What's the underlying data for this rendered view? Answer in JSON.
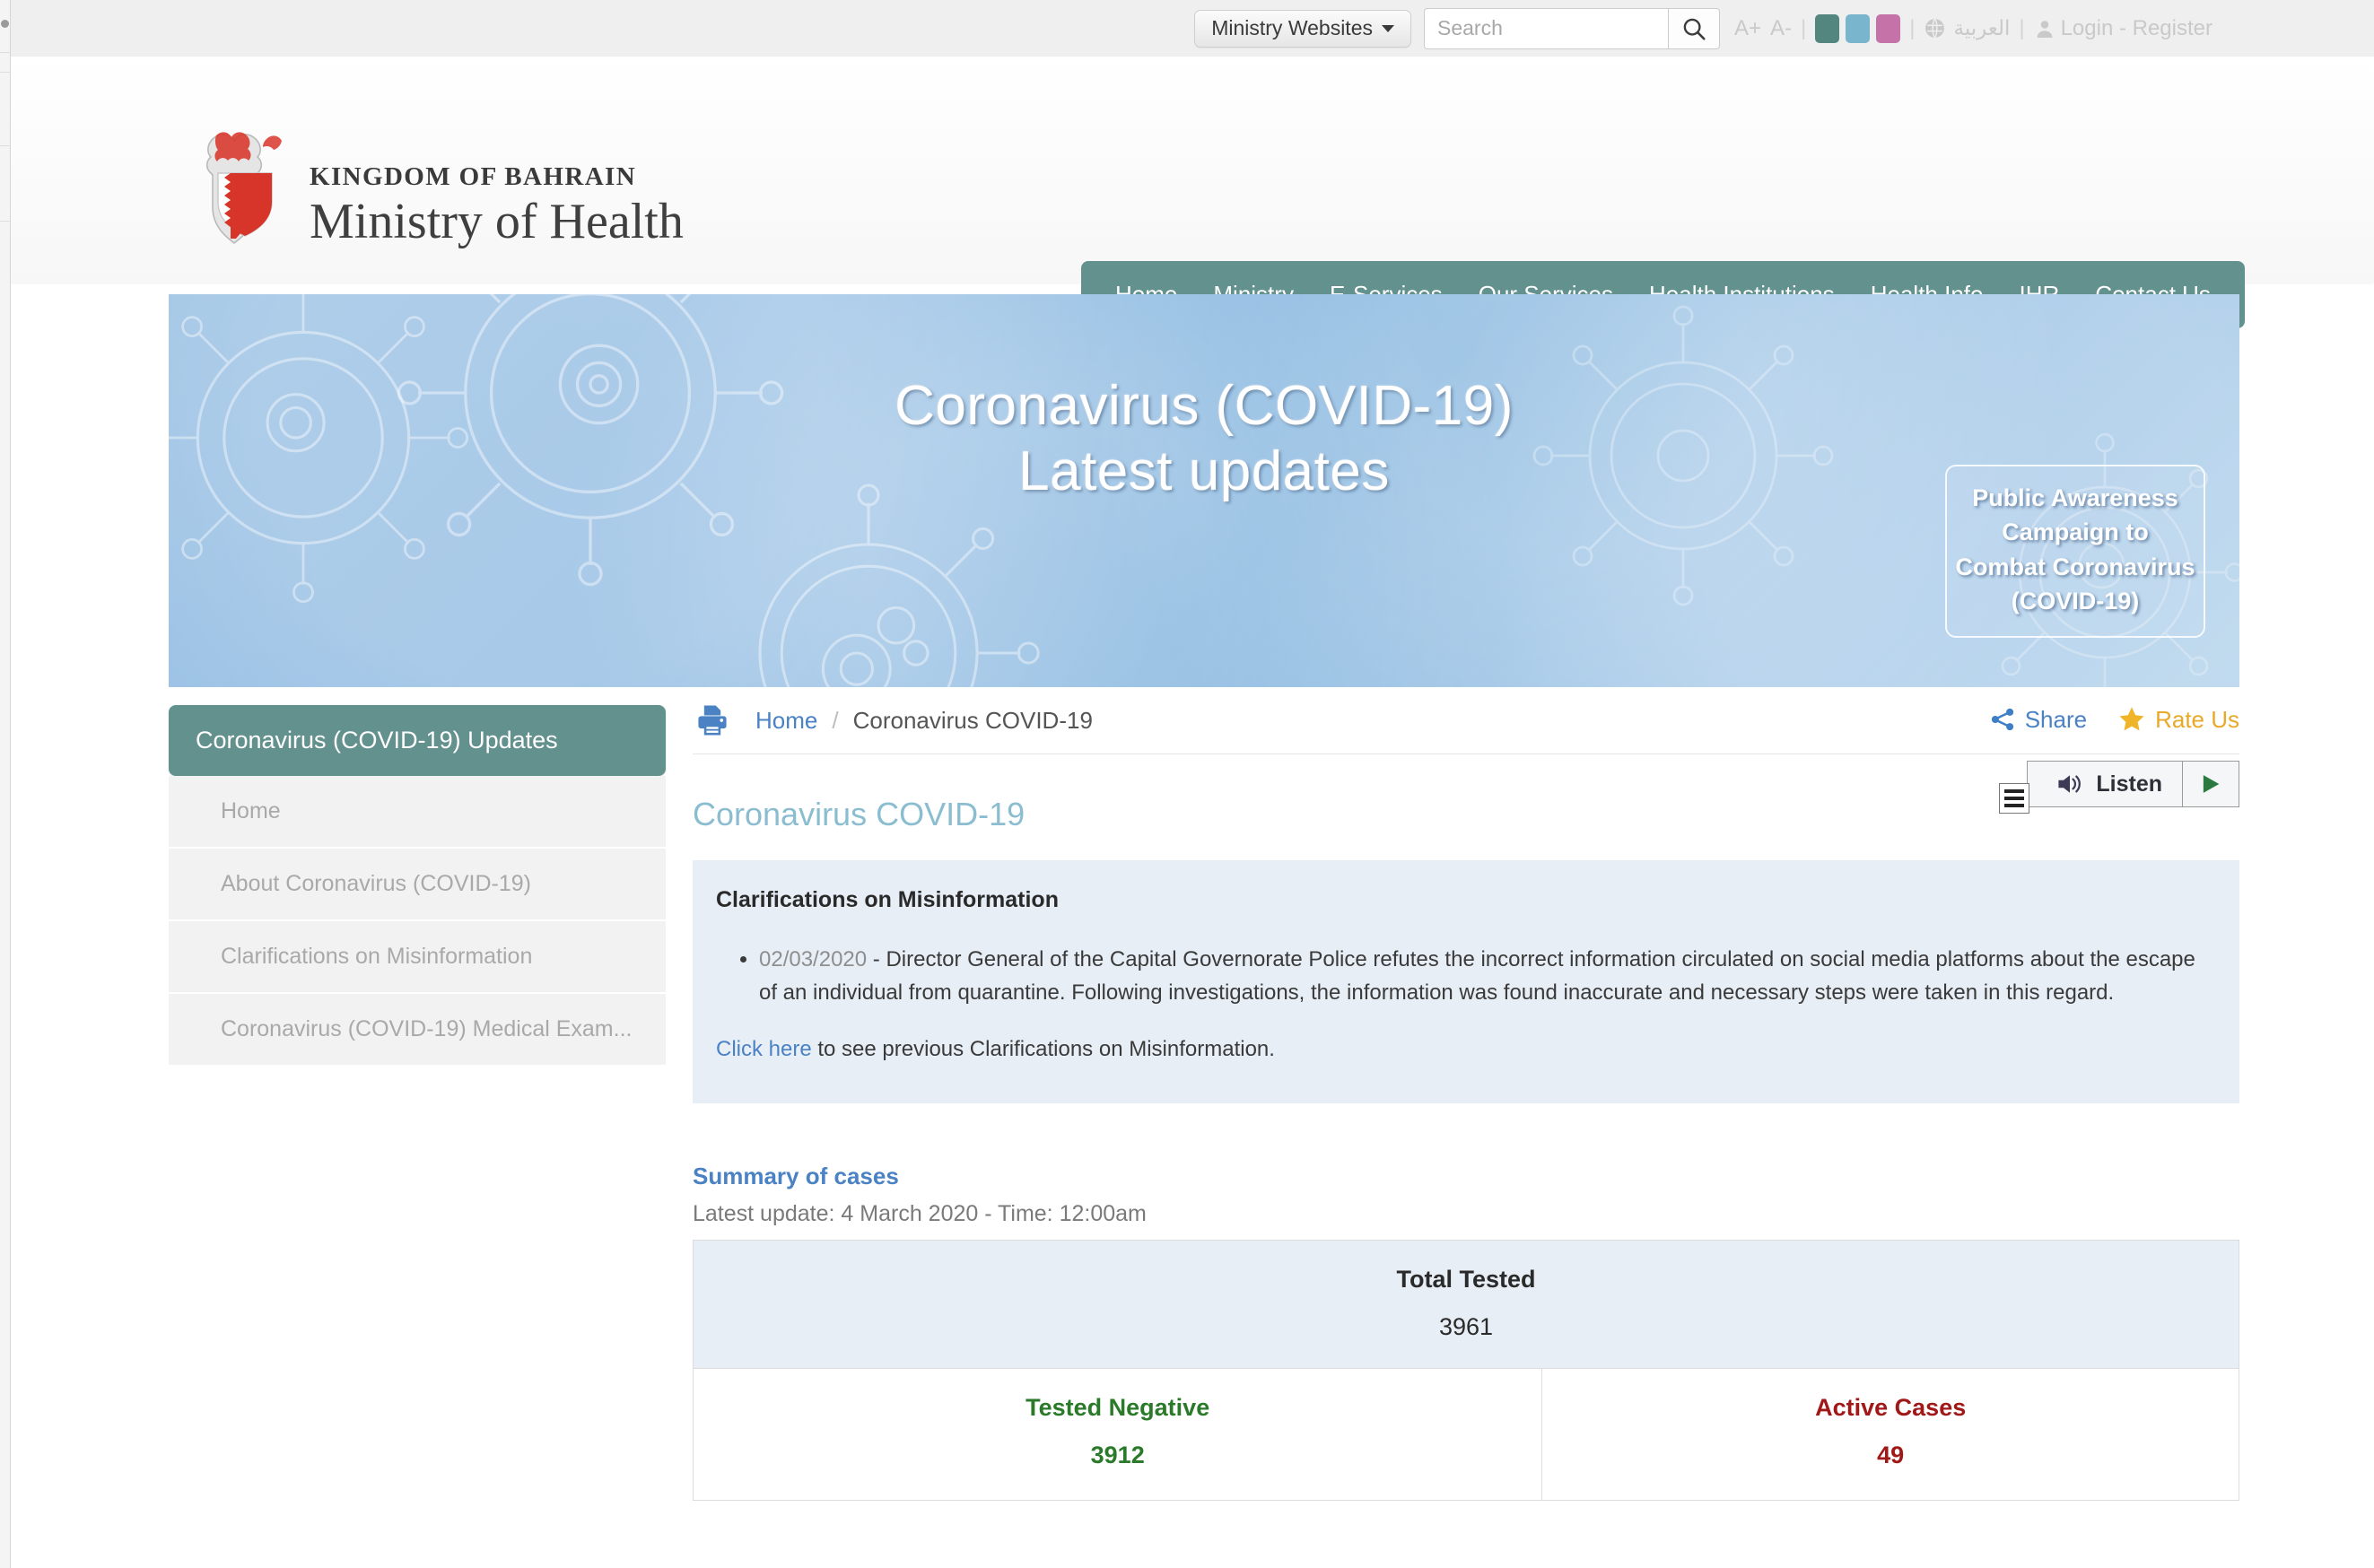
{
  "topbar": {
    "ministry_websites_label": "Ministry Websites",
    "search_placeholder": "Search",
    "search_value": "",
    "font_increase": "A+",
    "font_decrease": "A-",
    "separator": "|",
    "swatch_colors": [
      "#52867f",
      "#79b6cd",
      "#c472a8"
    ],
    "arabic_label": "العربية",
    "auth_label": "Login - Register"
  },
  "logo": {
    "kingdom_line": "KINGDOM OF BAHRAIN",
    "ministry_line": "Ministry of Health"
  },
  "mainnav": {
    "items": [
      {
        "label": "Home"
      },
      {
        "label": "Ministry"
      },
      {
        "label": "E-Services"
      },
      {
        "label": "Our Services"
      },
      {
        "label": "Health Institutions"
      },
      {
        "label": "Health Info"
      },
      {
        "label": "IHR"
      },
      {
        "label": "Contact Us"
      }
    ]
  },
  "hero": {
    "title_line1": "Coronavirus (COVID-19)",
    "title_line2": "Latest updates",
    "awareness_box": "Public Awareness Campaign to Combat Coronavirus (COVID-19)"
  },
  "sidebar": {
    "heading": "Coronavirus (COVID-19) Updates",
    "items": [
      {
        "label": "Home"
      },
      {
        "label": "About Coronavirus (COVID-19)"
      },
      {
        "label": "Clarifications on Misinformation"
      },
      {
        "label": "Coronavirus (COVID-19) Medical Exam..."
      }
    ]
  },
  "breadcrumb": {
    "home": "Home",
    "separator": "/",
    "current": "Coronavirus COVID-19"
  },
  "actions": {
    "share_label": "Share",
    "rate_label": "Rate Us",
    "listen_label": "Listen"
  },
  "main": {
    "page_title": "Coronavirus COVID-19",
    "notice": {
      "title": "Clarifications on Misinformation",
      "items": [
        {
          "date": "02/03/2020",
          "dash": " - ",
          "text": "Director General of the Capital Governorate Police refutes the incorrect information circulated on social media platforms about the escape of an individual from quarantine. Following investigations, the information was found inaccurate and necessary steps were taken in this regard."
        }
      ],
      "footer_link": "Click here",
      "footer_text": " to see previous Clarifications on Misinformation."
    },
    "summary": {
      "title": "Summary of cases",
      "update_label": "Latest update:",
      "update_value": " 4 March 2020 - Time: 12:00am"
    }
  },
  "chart_data": {
    "type": "table",
    "title": "Summary of cases",
    "total": {
      "label": "Total Tested",
      "value": "3961"
    },
    "categories": [
      "Tested Negative",
      "Active Cases"
    ],
    "values": [
      3912,
      49
    ],
    "value_strings": [
      "3912",
      "49"
    ],
    "colors": [
      "#2a7a2a",
      "#a01818"
    ]
  }
}
